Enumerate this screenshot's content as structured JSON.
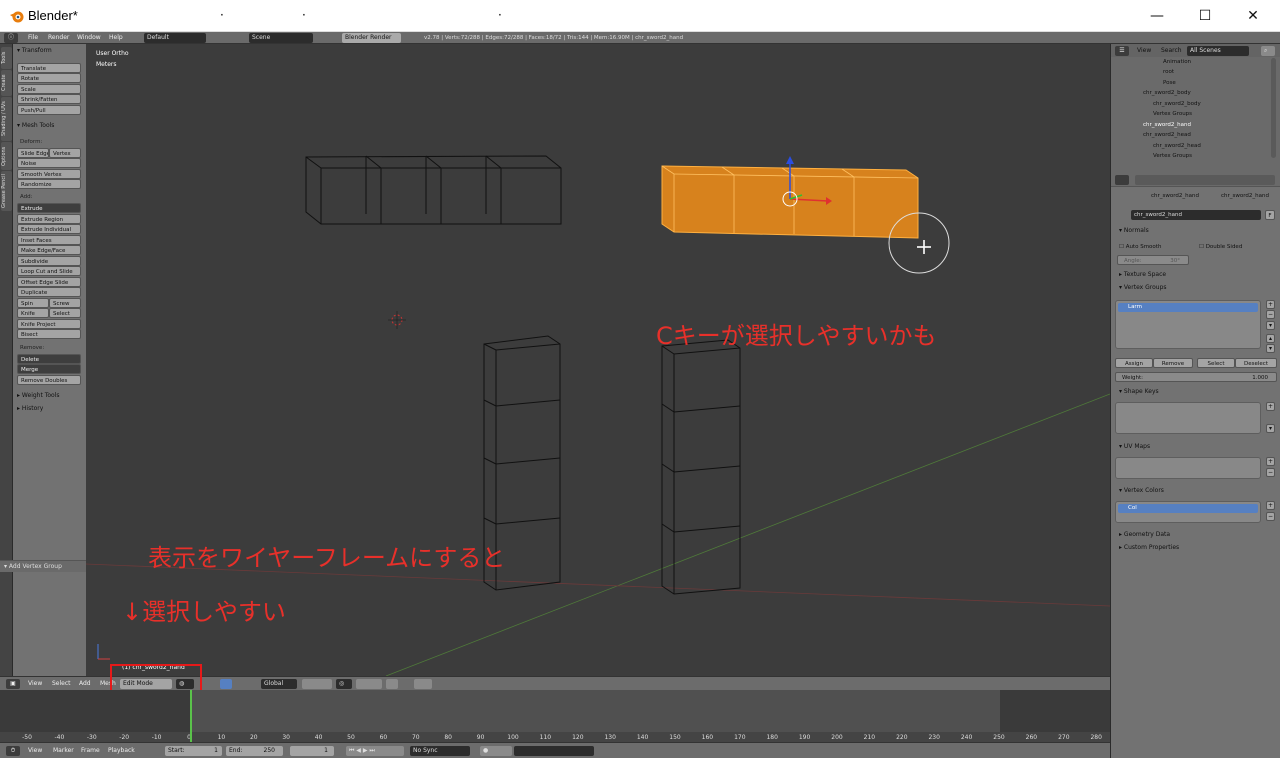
{
  "window": {
    "title": "Blender*",
    "minimize": "—",
    "maximize": "☐",
    "close": "✕",
    "dots": [
      "·",
      "·",
      "·"
    ]
  },
  "info_header": {
    "menus": [
      "File",
      "Render",
      "Window",
      "Help"
    ],
    "layout": "Default",
    "scene": "Scene",
    "engine": "Blender Render",
    "stats": "v2.78 | Verts:72/288 | Edges:72/288 | Faces:18/72 | Tris:144 | Mem:16.90M | chr_sword2_hand"
  },
  "tool_tabs": [
    "Tools",
    "Create",
    "Shading / UVs",
    "Options",
    "Grease Pencil"
  ],
  "tool_shelf": {
    "transform": {
      "title": "Transform",
      "buttons": [
        "Translate",
        "Rotate",
        "Scale",
        "Shrink/Fatten",
        "Push/Pull"
      ]
    },
    "mesh_tools": {
      "title": "Mesh Tools",
      "deform_label": "Deform:",
      "deform_pair": [
        "Slide Edge",
        "Vertex"
      ],
      "deform": [
        "Noise",
        "Smooth Vertex",
        "Randomize"
      ],
      "add_label": "Add:",
      "extrude": "Extrude",
      "add": [
        "Extrude Region",
        "Extrude Individual",
        "Inset Faces",
        "Make Edge/Face",
        "Subdivide",
        "Loop Cut and Slide",
        "Offset Edge Slide",
        "Duplicate"
      ],
      "spin_screw": [
        "Spin",
        "Screw"
      ],
      "knife_select": [
        "Knife",
        "Select"
      ],
      "add_tail": [
        "Knife Project",
        "Bisect"
      ],
      "remove_label": "Remove:",
      "delete": "Delete",
      "merge": "Merge",
      "remove_doubles": "Remove Doubles"
    },
    "weight_tools": "Weight Tools",
    "history": "History",
    "operator": "Add Vertex Group"
  },
  "viewport": {
    "view_label": "User Ortho",
    "units_label": "Meters",
    "object_label": "(1) chr_sword2_hand",
    "annotations": {
      "c_key": "Cキーが選択しやすいかも",
      "wireframe": "表示をワイヤーフレームにすると",
      "easier": "↓選択しやすい"
    }
  },
  "view3d_header": {
    "menus": [
      "View",
      "Select",
      "Add",
      "Mesh"
    ],
    "mode": "Edit Mode",
    "orientation": "Global"
  },
  "timeline": {
    "ticks": [
      "-50",
      "-40",
      "-30",
      "-20",
      "-10",
      "0",
      "10",
      "20",
      "30",
      "40",
      "50",
      "60",
      "70",
      "80",
      "90",
      "100",
      "110",
      "120",
      "130",
      "140",
      "150",
      "160",
      "170",
      "180",
      "190",
      "200",
      "210",
      "220",
      "230",
      "240",
      "250",
      "260",
      "270",
      "280"
    ],
    "menus": [
      "View",
      "Marker",
      "Frame",
      "Playback"
    ],
    "start": "Start:",
    "start_val": "1",
    "end": "End:",
    "end_val": "250",
    "current": "1",
    "sync": "No Sync"
  },
  "outliner": {
    "menus": [
      "View",
      "Search"
    ],
    "filter": "All Scenes",
    "rows": [
      "Animation",
      "root",
      "Pose",
      "chr_sword2_body",
      "chr_sword2_body",
      "Vertex Groups",
      "chr_sword2_hand",
      "chr_sword2_head",
      "chr_sword2_head",
      "Vertex Groups"
    ]
  },
  "properties": {
    "breadcrumb_obj": "chr_sword2_hand",
    "breadcrumb_mesh": "chr_sword2_hand",
    "mesh_name": "chr_sword2_hand",
    "fake_user": "F",
    "normals": "Normals",
    "auto_smooth": "Auto Smooth",
    "double_sided": "Double Sided",
    "angle_label": "Angle:",
    "angle_value": "30°",
    "texture_space": "Texture Space",
    "vertex_groups": "Vertex Groups",
    "vg_item": "Larm",
    "vg_buttons": [
      "Assign",
      "Remove",
      "Select",
      "Deselect"
    ],
    "weight_label": "Weight:",
    "weight_value": "1.000",
    "shape_keys": "Shape Keys",
    "uv_maps": "UV Maps",
    "vertex_colors": "Vertex Colors",
    "vc_item": "Col",
    "geometry_data": "Geometry Data",
    "custom_props": "Custom Properties"
  },
  "colors": {
    "selection_orange": "#e88a1a",
    "annotation_red": "#e8302a",
    "highlight_blue": "#5680c2",
    "frame_green": "#5ac24a"
  }
}
